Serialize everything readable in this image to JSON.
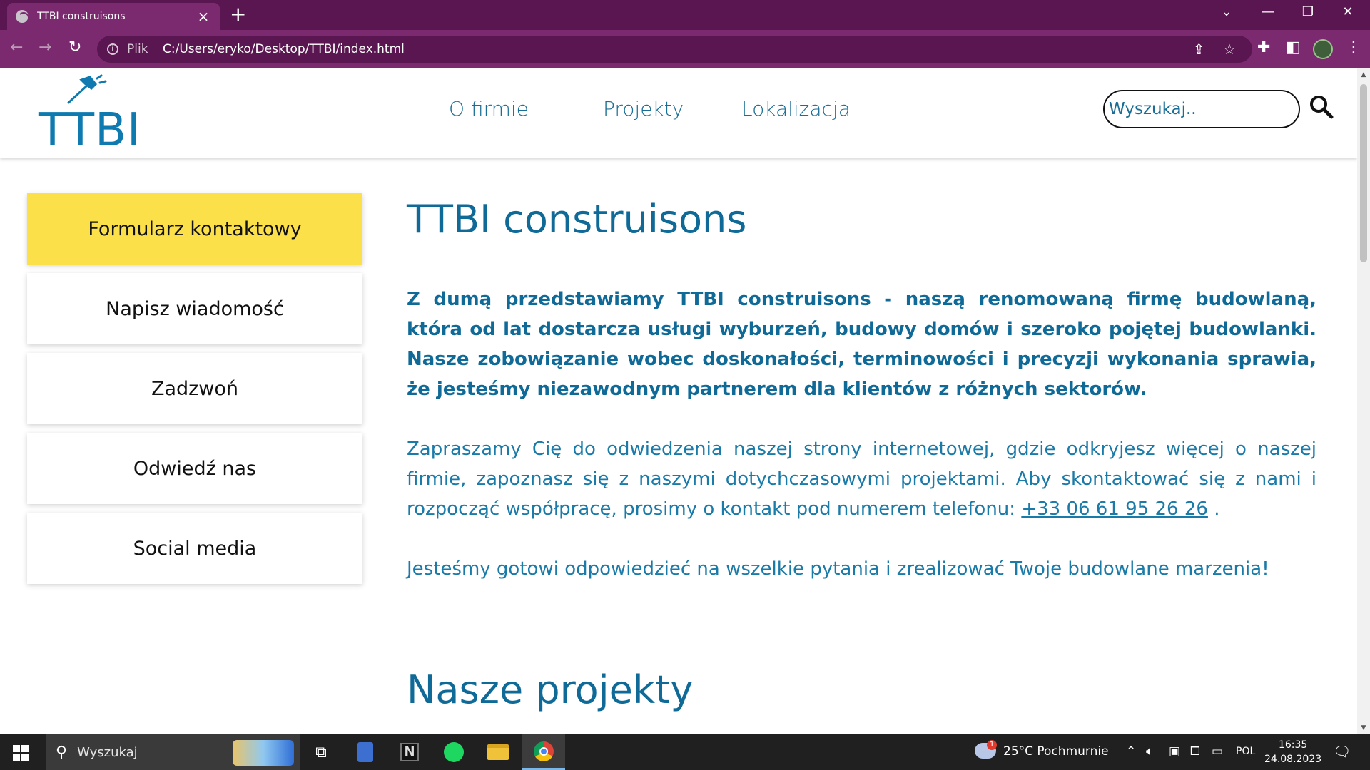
{
  "browser": {
    "tab_title": "TTBI construisons",
    "scheme_label": "Plik",
    "url": "C:/Users/eryko/Desktop/TTBI/index.html"
  },
  "site": {
    "logo_text": "TTBI",
    "nav": [
      "O firmie",
      "Projekty",
      "Lokalizacja"
    ],
    "search_placeholder": "Wyszukaj..",
    "side_menu": [
      "Formularz kontaktowy",
      "Napisz wiadomość",
      "Zadzwoń",
      "Odwiedź nas",
      "Social media"
    ],
    "title": "TTBI construisons",
    "lead": "Z dumą przedstawiamy TTBI construisons - naszą renomowaną firmę budowlaną, która od lat dostarcza usługi wyburzeń, budowy domów i szeroko pojętej budowlanki. Nasze zobowiązanie wobec doskonałości, terminowości i precyzji wykonania sprawia, że jesteśmy niezawodnym partnerem dla klientów z różnych sektorów.",
    "paragraph2": "Zapraszamy Cię do odwiedzenia naszej strony internetowej, gdzie odkryjesz więcej o naszej firmie, zapoznasz się z naszymi dotychczasowymi projektami. Aby skontaktować się z nami i rozpocząć współpracę, prosimy o kontakt pod numerem telefonu:",
    "phone": "+33 06 61 95 26 26",
    "paragraph2_end": ".",
    "paragraph3": "Jesteśmy gotowi odpowiedzieć na wszelkie pytania i zrealizować Twoje budowlane marzenia!",
    "section_title": "Nasze projekty"
  },
  "taskbar": {
    "search_label": "Wyszukaj",
    "weather": "25°C Pochmurnie",
    "weather_badge": "1",
    "language": "POL",
    "time": "16:35",
    "date": "24.08.2023"
  },
  "colors": {
    "brand_blue": "#0f6a98",
    "active_menu": "#fbe04a",
    "browser_frame": "#5a1650"
  },
  "icons": [
    "globe-icon",
    "close-icon",
    "plus-icon",
    "back-icon",
    "forward-icon",
    "reload-icon",
    "info-icon",
    "share-icon",
    "star-icon",
    "extensions-icon",
    "sidepanel-icon",
    "profile-icon",
    "menu-icon",
    "hammer-icon",
    "search-icon",
    "windows-icon",
    "task-view-icon",
    "calculator-icon",
    "notion-icon",
    "spotify-icon",
    "folder-icon",
    "chrome-icon",
    "weather-icon",
    "chevron-up-icon",
    "speaker-icon",
    "camera-icon",
    "display-icon",
    "battery-icon",
    "notification-icon"
  ]
}
